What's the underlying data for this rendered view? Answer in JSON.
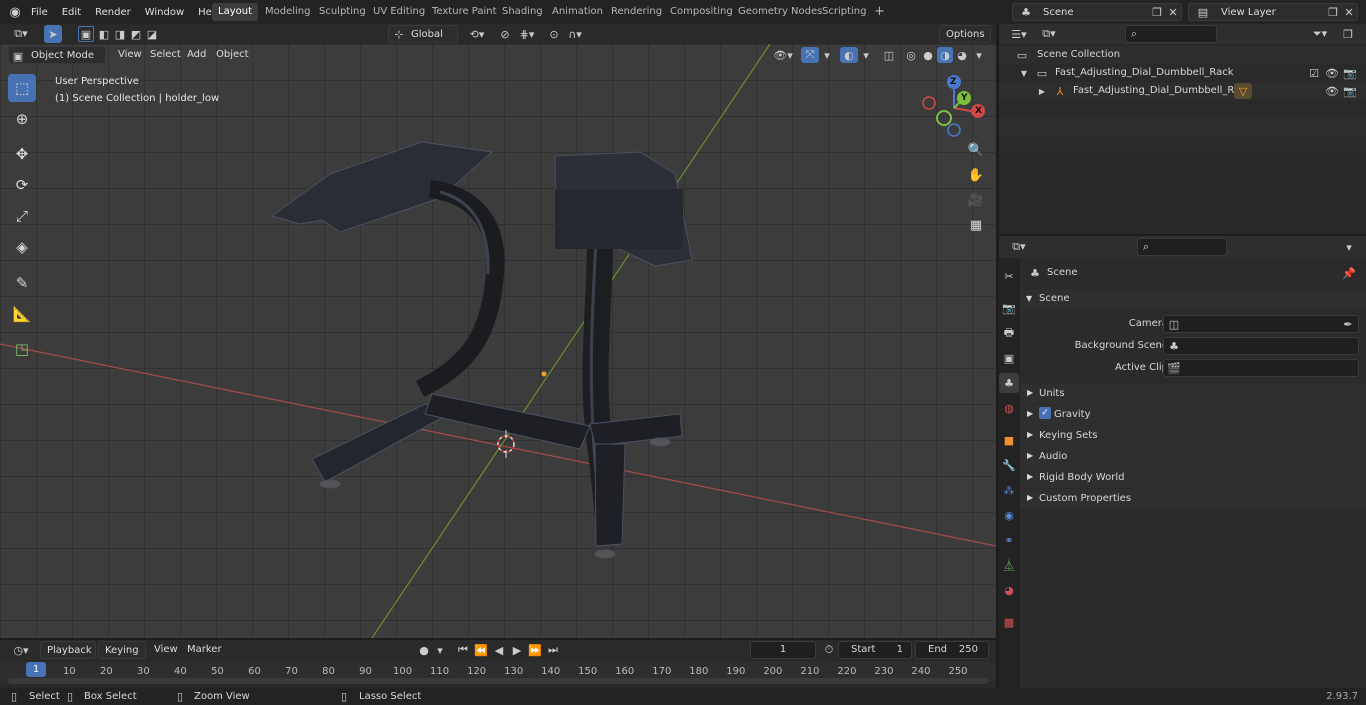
{
  "topbar": {
    "menus": [
      "File",
      "Edit",
      "Render",
      "Window",
      "Help"
    ],
    "workspaces": [
      "Layout",
      "Modeling",
      "Sculpting",
      "UV Editing",
      "Texture Paint",
      "Shading",
      "Animation",
      "Rendering",
      "Compositing",
      "Geometry Nodes",
      "Scripting"
    ],
    "active_workspace": "Layout",
    "scene": "Scene",
    "view_layer": "View Layer",
    "add_tab": "+"
  },
  "viewport": {
    "mode": "Object Mode",
    "menus": [
      "View",
      "Select",
      "Add",
      "Object"
    ],
    "orientation": "Global",
    "options": "Options",
    "overlay_title": "User Perspective",
    "overlay_sub": "(1) Scene Collection | holder_low",
    "gizmo": {
      "z": "Z",
      "y": "Y",
      "x": "X"
    }
  },
  "outliner": {
    "root": "Scene Collection",
    "collection": "Fast_Adjusting_Dial_Dumbbell_Rack",
    "object": "Fast_Adjusting_Dial_Dumbbell_Rack"
  },
  "properties": {
    "header": "Scene",
    "section": "Scene",
    "rows": [
      {
        "label": "Camera"
      },
      {
        "label": "Background Scene"
      },
      {
        "label": "Active Clip"
      }
    ],
    "panels": [
      "Units",
      "Gravity",
      "Keying Sets",
      "Audio",
      "Rigid Body World",
      "Custom Properties"
    ]
  },
  "timeline": {
    "menus": [
      "Playback",
      "Keying",
      "View",
      "Marker"
    ],
    "current_frame": "1",
    "start_label": "Start",
    "start": "1",
    "end_label": "End",
    "end": "250",
    "ticks": [
      "10",
      "20",
      "30",
      "40",
      "50",
      "60",
      "70",
      "80",
      "90",
      "100",
      "110",
      "120",
      "130",
      "140",
      "150",
      "160",
      "170",
      "180",
      "190",
      "200",
      "210",
      "220",
      "230",
      "240",
      "250"
    ],
    "playhead": "1"
  },
  "statusbar": {
    "select": "Select",
    "box_select": "Box Select",
    "zoom_view": "Zoom View",
    "lasso_select": "Lasso Select",
    "version": "2.93.7"
  },
  "colors": {
    "accent": "#4772b3",
    "x_axis": "#b34a4a",
    "y_axis": "#6f9a2e",
    "bg": "#3c3c3c",
    "panel": "#2b2b2b"
  }
}
